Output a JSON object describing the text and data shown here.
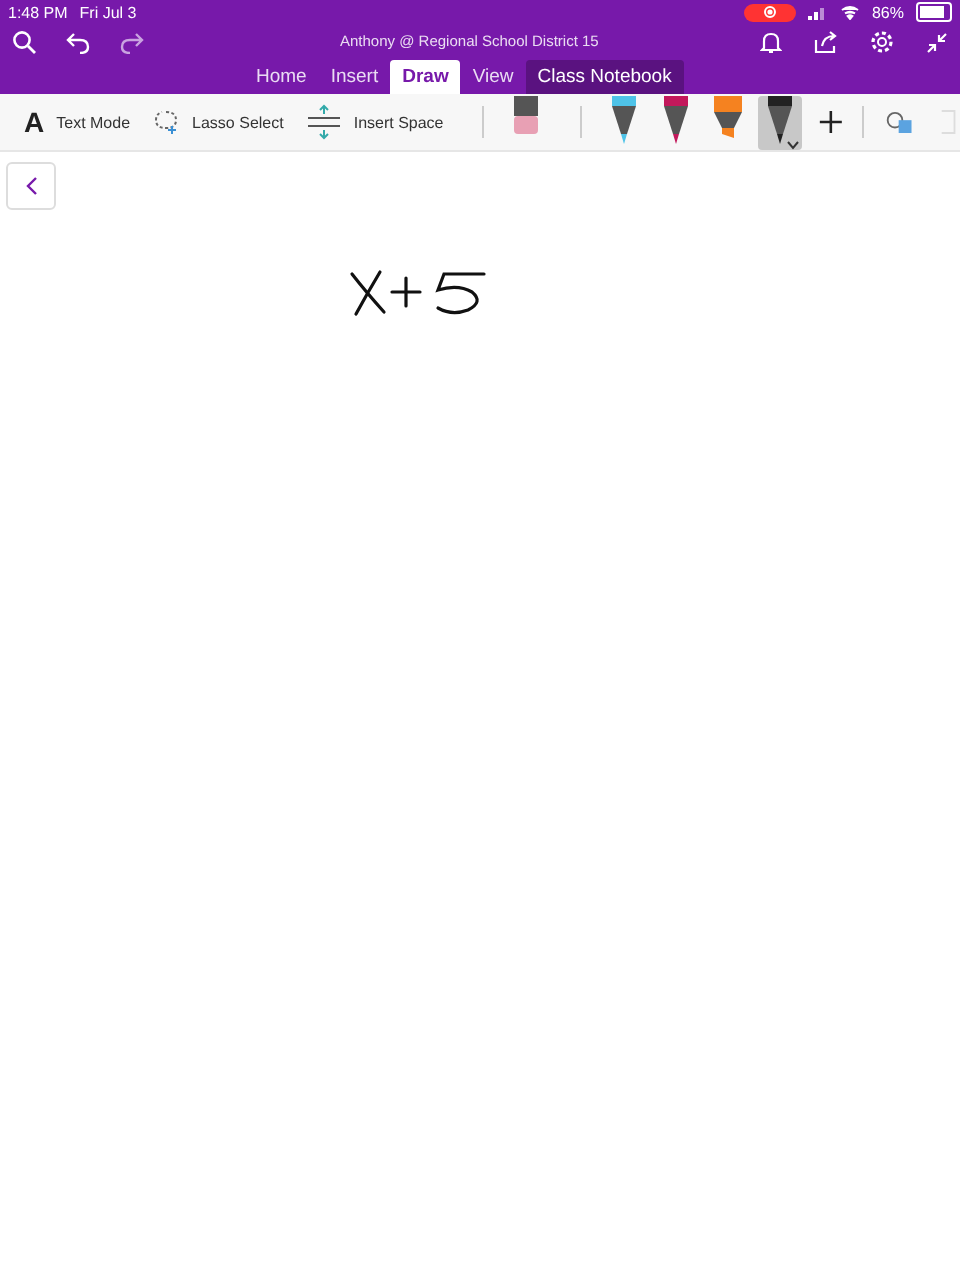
{
  "status_bar": {
    "time": "1:48 PM",
    "date": "Fri Jul 3",
    "recording": true,
    "battery_text": "86%"
  },
  "title": "Anthony @ Regional School District 15",
  "tabs": [
    {
      "label": "Home",
      "selected": false
    },
    {
      "label": "Insert",
      "selected": false
    },
    {
      "label": "Draw",
      "selected": true
    },
    {
      "label": "View",
      "selected": false
    },
    {
      "label": "Class Notebook",
      "selected": false
    }
  ],
  "tools": [
    {
      "kind": "text",
      "icon": "A",
      "label": "Text Mode"
    },
    {
      "kind": "lasso",
      "label": "Lasso Select"
    },
    {
      "kind": "space",
      "label": "Insert Space"
    }
  ],
  "pens": [
    {
      "kind": "eraser",
      "color": "#e8a0b4",
      "selected": false
    },
    {
      "kind": "pen",
      "color": "#4fc3e8",
      "selected": false
    },
    {
      "kind": "pen",
      "color": "#c2185b",
      "selected": false
    },
    {
      "kind": "highlighter",
      "color": "#f58220",
      "selected": false
    },
    {
      "kind": "pen",
      "color": "#222222",
      "selected": true
    }
  ]
}
